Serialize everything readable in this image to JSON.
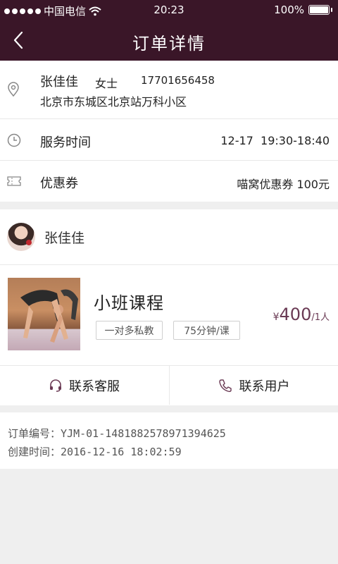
{
  "status_bar": {
    "carrier": "中国电信",
    "time": "20:23",
    "battery": "100%"
  },
  "header": {
    "title": "订单详情"
  },
  "address": {
    "name": "张佳佳",
    "gender": "女士",
    "phone": "17701656458",
    "detail": "北京市东城区北京站万科小区"
  },
  "service_time": {
    "label": "服务时间",
    "value": "12-17  19:30-18:40"
  },
  "coupon": {
    "label": "优惠券",
    "value": "喵窝优惠券 100元"
  },
  "seller": {
    "name": "张佳佳"
  },
  "course": {
    "title": "小班课程",
    "tags": [
      "一对多私教",
      "75分钟/课"
    ],
    "price_symbol": "¥",
    "price": "400",
    "price_unit": "/1人"
  },
  "actions": {
    "contact_service": "联系客服",
    "contact_user": "联系用户"
  },
  "order": {
    "number_label": "订单编号：",
    "number": "YJM-01-1481882578971394625",
    "created_label": "创建时间：",
    "created": "2016-12-16 18:02:59"
  },
  "colors": {
    "header_bg": "#3a1628",
    "accent": "#6a3a54",
    "page_bg": "#efefef"
  },
  "icons": {
    "location": "location-pin-icon",
    "clock": "clock-icon",
    "coupon": "ticket-icon",
    "service": "headset-icon",
    "phone": "phone-icon",
    "back": "chevron-left-icon"
  }
}
